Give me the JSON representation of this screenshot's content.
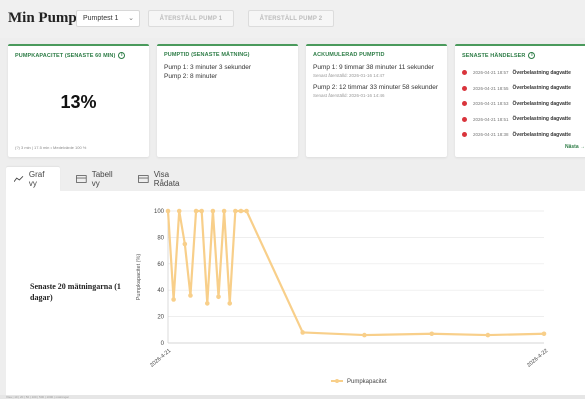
{
  "header": {
    "title": "Min Pump",
    "pump_select": "Pumptest 1",
    "reset_pump_1": "ÅTERSTÄLL PUMP 1",
    "reset_pump_2": "ÅTERSTÄLL PUMP 2"
  },
  "cards": {
    "capacity": {
      "title": "PUMPKAPACITET (SENASTE 60 MIN)",
      "value": "13%",
      "footer": "(?) 3 min | 17.5 min • Medelvärde 100 %"
    },
    "pumptime": {
      "title": "PUMPTID (SENASTE MÄTNING)",
      "pump1": "Pump 1: 3 minuter 3 sekunder",
      "pump2": "Pump 2: 8 minuter"
    },
    "accumulated": {
      "title": "ACKUMULERAD PUMPTID",
      "pump1": "Pump 1: 9 timmar 38 minuter 11 sekunder",
      "pump1_reset": "Senast återställd: 2026-01-16 14:47",
      "pump2": "Pump 2: 12 timmar 33 minuter 58 sekunder",
      "pump2_reset": "Senast återställd: 2026-01-16 14:46"
    },
    "events": {
      "title": "SENASTE HÄNDELSER",
      "items": [
        {
          "time": "2026-04-21 18:57",
          "msg": "Överbelastning dagvatte"
        },
        {
          "time": "2026-04-21 18:55",
          "msg": "Överbelastning dagvatte"
        },
        {
          "time": "2026-04-21 18:53",
          "msg": "Överbelastning dagvatte"
        },
        {
          "time": "2026-04-21 18:51",
          "msg": "Överbelastning dagvatte"
        },
        {
          "time": "2026-04-21 18:38",
          "msg": "Överbelastning dagvatte"
        }
      ],
      "more": "Nästa →"
    }
  },
  "tabs": {
    "graph": "Graf vy",
    "table": "Tabell vy",
    "data": "Visa Rådata"
  },
  "chart_side_label": "Senaste 20 mätningarna (1 dagar)",
  "footer": "Visa | 10 | 20 | 50 | 100 | 500 | 1000 | mätningar",
  "colors": {
    "accent": "#2e7d47",
    "series": "#f8cf8a",
    "event_dot": "#d9343c"
  },
  "chart_data": {
    "type": "line",
    "title": "",
    "xlabel": "",
    "ylabel": "Pumpkapacitet (%)",
    "ylim": [
      0,
      100
    ],
    "yticks": [
      0,
      20,
      40,
      60,
      80,
      100
    ],
    "x_tick_labels": [
      "2026-4-21",
      "2026-4-22"
    ],
    "legend": "bottom",
    "grid": true,
    "series": [
      {
        "name": "Pumpkapacitet",
        "x": [
          0.0,
          0.05,
          0.1,
          0.15,
          0.2,
          0.25,
          0.3,
          0.35,
          0.4,
          0.45,
          0.5,
          0.55,
          0.6,
          0.65,
          0.7,
          1.2,
          1.75,
          2.35,
          2.85,
          3.35
        ],
        "values": [
          100,
          33,
          100,
          75,
          36,
          100,
          100,
          30,
          100,
          35,
          100,
          30,
          100,
          100,
          100,
          8,
          6,
          7,
          6,
          7
        ]
      }
    ]
  }
}
